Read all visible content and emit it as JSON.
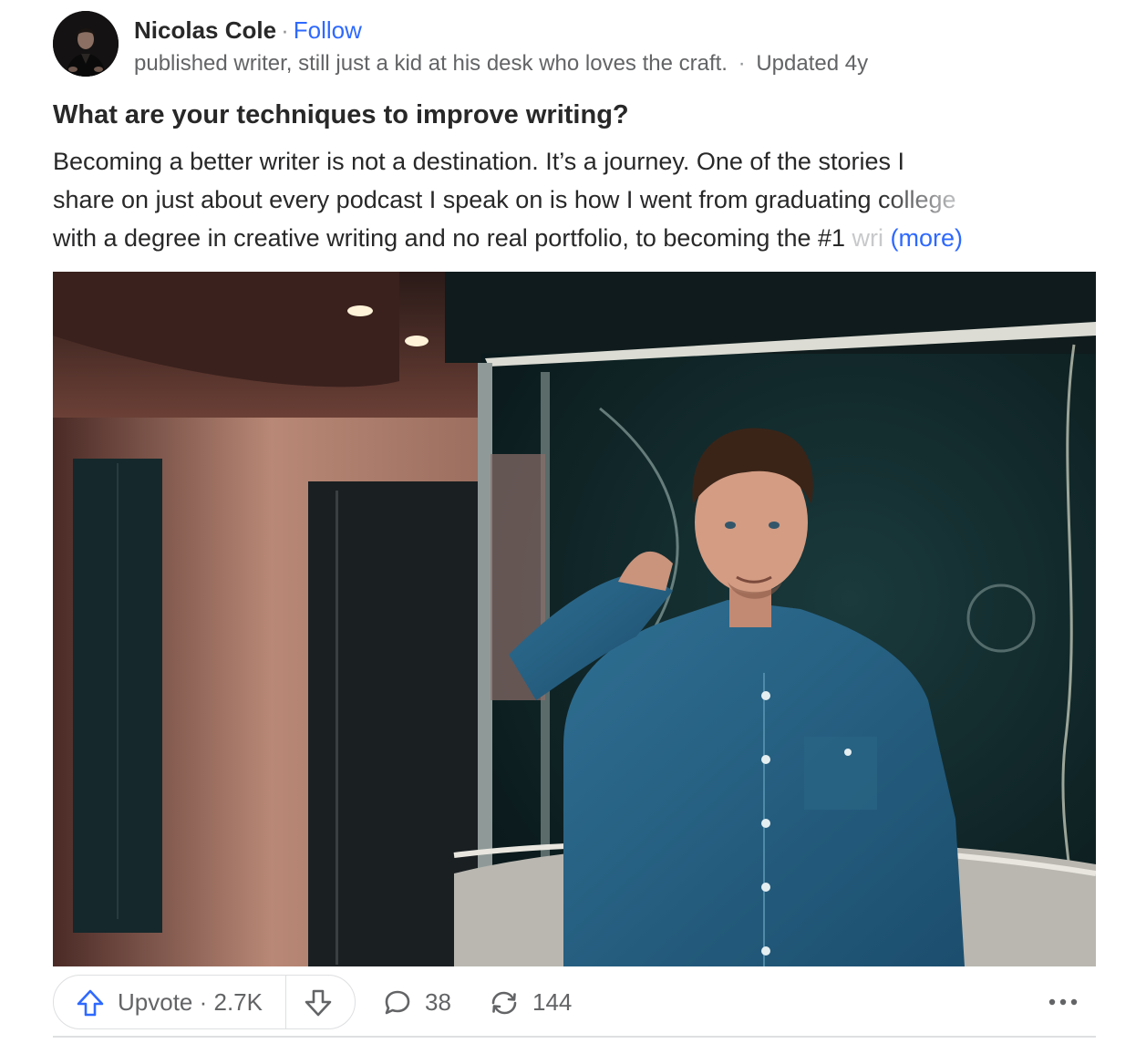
{
  "author": {
    "name": "Nicolas Cole",
    "separator": "·",
    "follow_label": "Follow",
    "credential": "published writer, still just a kid at his desk who loves the craft.",
    "meta_separator": "·",
    "updated": "Updated 4y"
  },
  "question": {
    "title": "What are your techniques to improve writing?"
  },
  "answer": {
    "lines": [
      "Becoming a better writer is not a destination. It’s a journey. One of the stories I",
      "share on just about every podcast I speak on is how I went from graduating "
    ],
    "line2_fade": "college",
    "line3": "with a degree in creative writing and no real portfolio, to becoming the #1 ",
    "line3_fade": "wri",
    "more_label": "(more)"
  },
  "photo": {
    "icon": "answer-photo"
  },
  "actions": {
    "upvote_label": "Upvote · 2.7K",
    "comment_count": "38",
    "share_count": "144",
    "icons": {
      "upvote": "arrow-up-icon",
      "downvote": "arrow-down-icon",
      "comment": "comment-bubble-icon",
      "share": "share-cycle-icon",
      "overflow": "more-dots-icon"
    }
  },
  "colors": {
    "link": "#2e69ff",
    "text": "#282829",
    "secondary": "#636466",
    "border": "#dedfe1"
  }
}
